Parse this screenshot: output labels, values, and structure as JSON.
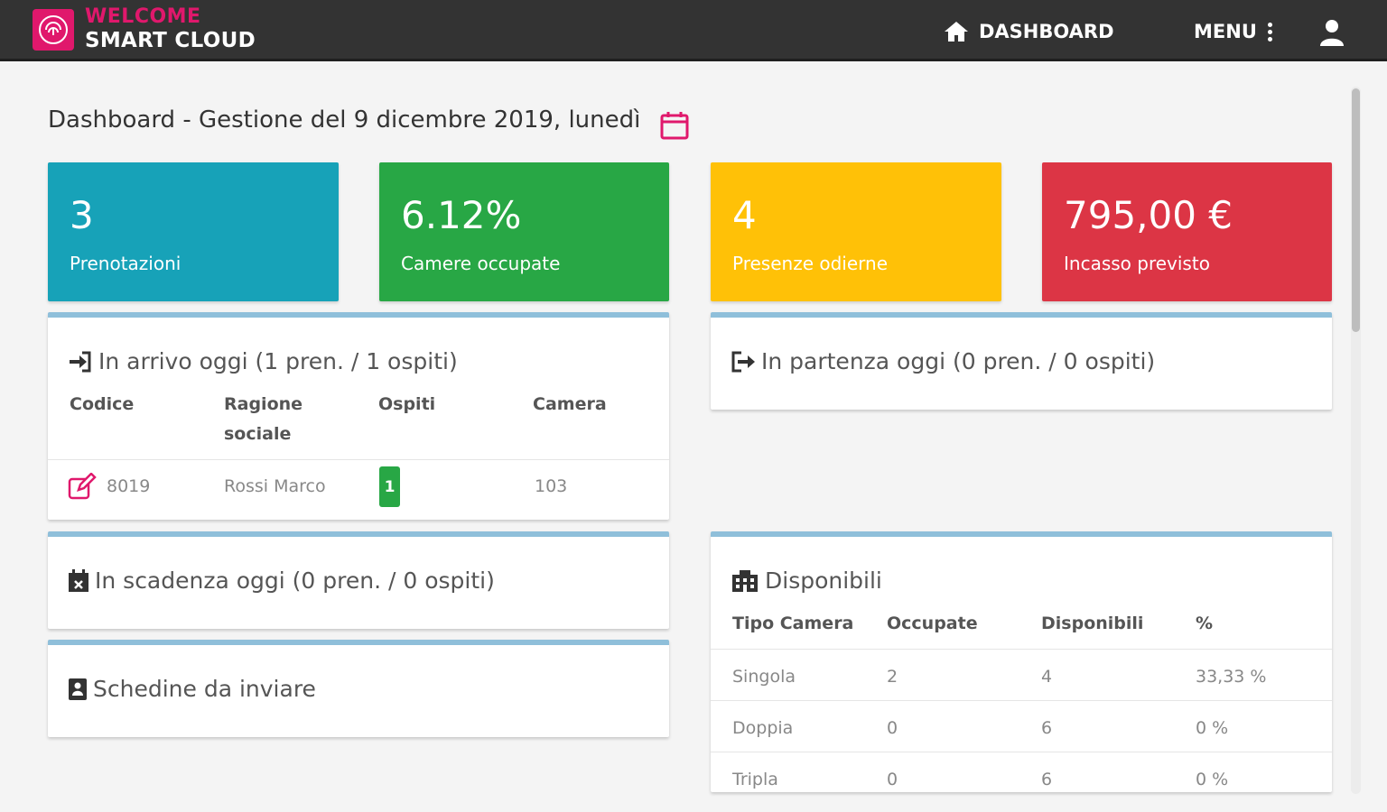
{
  "header": {
    "brand_top": "WELCOME",
    "brand_bottom": "SMART CLOUD",
    "nav_dashboard": "DASHBOARD",
    "nav_menu": "MENU"
  },
  "page": {
    "title": "Dashboard - Gestione del 9 dicembre 2019, lunedì"
  },
  "stats": [
    {
      "value": "3",
      "label": "Prenotazioni",
      "color": "#17a2b8"
    },
    {
      "value": "6.12%",
      "label": "Camere occupate",
      "color": "#28a745"
    },
    {
      "value": "4",
      "label": "Presenze odierne",
      "color": "#ffc107"
    },
    {
      "value": "795,00 €",
      "label": "Incasso previsto",
      "color": "#dc3545"
    }
  ],
  "arrivals": {
    "title": "In arrivo oggi (1 pren. / 1 ospiti)",
    "columns": [
      "Codice",
      "Ragione sociale",
      "Ospiti",
      "Camera"
    ],
    "rows": [
      {
        "code": "8019",
        "name": "Rossi Marco",
        "guests": "1",
        "room": "103"
      }
    ]
  },
  "departures": {
    "title": "In partenza oggi (0 pren. / 0 ospiti)"
  },
  "expiring": {
    "title": "In scadenza oggi (0 pren. / 0 ospiti)"
  },
  "forms": {
    "title": "Schedine da inviare"
  },
  "available": {
    "title": "Disponibili",
    "columns": [
      "Tipo Camera",
      "Occupate",
      "Disponibili",
      "%"
    ],
    "rows": [
      {
        "type": "Singola",
        "occupied": "2",
        "available": "4",
        "pct": "33,33 %"
      },
      {
        "type": "Doppia",
        "occupied": "0",
        "available": "6",
        "pct": "0 %"
      },
      {
        "type": "Tripla",
        "occupied": "0",
        "available": "6",
        "pct": "0 %"
      }
    ]
  },
  "colors": {
    "brand": "#e0186c",
    "topbar": "#333333",
    "panel_accent": "#8fbfda"
  }
}
